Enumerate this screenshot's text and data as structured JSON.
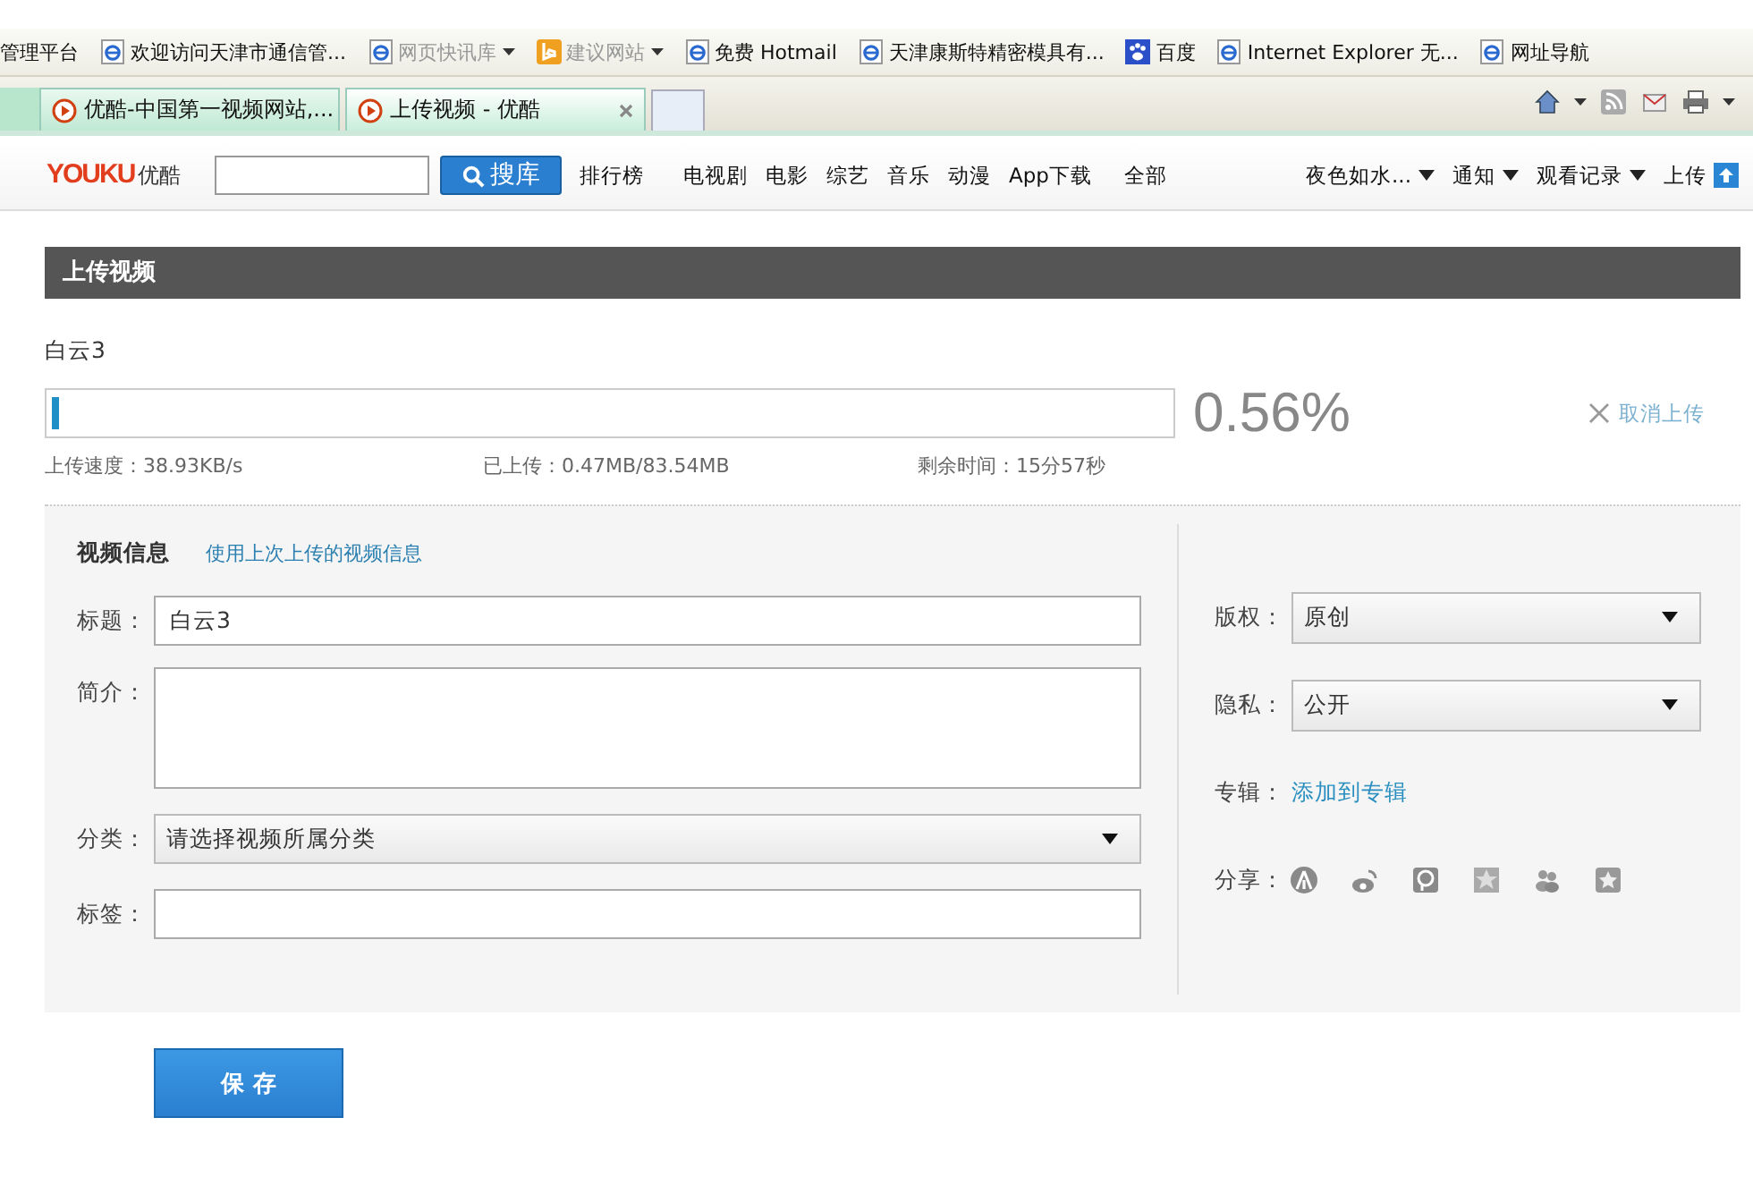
{
  "bookmarks": [
    {
      "label": "管理平台",
      "kind": "none",
      "disabled": false,
      "dropdown": false
    },
    {
      "label": "欢迎访问天津市通信管...",
      "kind": "ie",
      "disabled": false,
      "dropdown": false
    },
    {
      "label": "网页快讯库",
      "kind": "ie",
      "disabled": true,
      "dropdown": true
    },
    {
      "label": "建议网站",
      "kind": "bing",
      "disabled": true,
      "dropdown": true
    },
    {
      "label": "免费 Hotmail",
      "kind": "ie",
      "disabled": false,
      "dropdown": false
    },
    {
      "label": "天津康斯特精密模具有...",
      "kind": "ie",
      "disabled": false,
      "dropdown": false
    },
    {
      "label": "百度",
      "kind": "paw",
      "disabled": false,
      "dropdown": false
    },
    {
      "label": "Internet Explorer 无...",
      "kind": "ie",
      "disabled": false,
      "dropdown": false
    },
    {
      "label": "网址导航",
      "kind": "ie",
      "disabled": false,
      "dropdown": false
    }
  ],
  "tabs": [
    {
      "label": "优酷-中国第一视频网站,...",
      "selected": false
    },
    {
      "label": "上传视频 - 优酷",
      "selected": true
    }
  ],
  "header": {
    "logo": "YOUKU",
    "logo_cn": "优酷",
    "search_button": "搜库",
    "nav": [
      "排行榜",
      "电视剧",
      "电影",
      "综艺",
      "音乐",
      "动漫",
      "App下载",
      "全部"
    ],
    "user_menu": [
      "夜色如水...",
      "通知",
      "观看记录"
    ],
    "upload": "上传"
  },
  "section_title": "上传视频",
  "upload": {
    "filename": "白云3",
    "level": 0.0056,
    "percent": "0.56%",
    "cancel": "取消上传",
    "speed": "上传速度：38.93KB/s",
    "uploaded": "已上传：0.47MB/83.54MB",
    "remaining": "剩余时间：15分57秒"
  },
  "form": {
    "heading": "视频信息",
    "reuse_link": "使用上次上传的视频信息",
    "fields": [
      {
        "label": "标题：",
        "kind": "text",
        "value": "白云3"
      },
      {
        "label": "简介：",
        "kind": "textarea"
      },
      {
        "label": "分类：",
        "kind": "select",
        "value": "请选择视频所属分类"
      },
      {
        "label": "标签：",
        "kind": "text"
      }
    ],
    "side": [
      {
        "label": "版权：",
        "kind": "select",
        "value": "原创"
      },
      {
        "label": "隐私：",
        "kind": "select",
        "value": "公开"
      },
      {
        "label": "专辑：",
        "kind": "link",
        "value": "添加到专辑"
      },
      {
        "label": "分享：",
        "kind": "share"
      }
    ]
  },
  "save": "保 存"
}
